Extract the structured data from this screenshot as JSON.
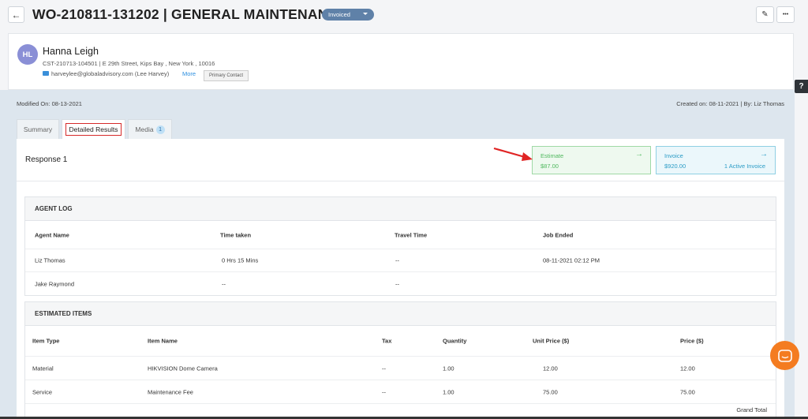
{
  "header": {
    "back_icon": "←",
    "title": "WO-210811-131202 | GENERAL MAINTENANCE",
    "status": "Invoiced",
    "edit_icon": "✎",
    "more_icon": "•••"
  },
  "customer": {
    "initials": "HL",
    "name": "Hanna Leigh",
    "address": "CST-210713-104501 | E 29th Street, Kips Bay , New York , 10016",
    "email": "harveylee@globaladvisory.com (Lee Harvey)",
    "more_label": "More",
    "badge": "Primary Contact"
  },
  "meta": {
    "modified": "Modified On: 08-13-2021",
    "created": "Created on: 08-11-2021 | By: Liz Thomas"
  },
  "tabs": {
    "summary": "Summary",
    "detailed": "Detailed Results",
    "media": "Media",
    "media_count": "1"
  },
  "response": {
    "title": "Response 1",
    "estimate": {
      "label": "Estimate",
      "amount": "$87.00",
      "arrow": "→"
    },
    "invoice": {
      "label": "Invoice",
      "amount": "$920.00",
      "extra": "1 Active Invoice",
      "arrow": "→"
    }
  },
  "agent_log": {
    "title": "AGENT LOG",
    "columns": [
      "Agent Name",
      "Time taken",
      "Travel Time",
      "Job Ended"
    ],
    "rows": [
      [
        "Liz Thomas",
        "0 Hrs 15 Mins",
        "--",
        "08-11-2021 02:12 PM"
      ],
      [
        "Jake Raymond",
        "--",
        "--",
        ""
      ]
    ]
  },
  "estimated_items": {
    "title": "ESTIMATED ITEMS",
    "columns": [
      "Item Type",
      "Item Name",
      "Tax",
      "Quantity",
      "Unit Price ($)",
      "Price ($)"
    ],
    "rows": [
      [
        "Material",
        "HIKVISION Dome Camera",
        "--",
        "1.00",
        "12.00",
        "12.00"
      ],
      [
        "Service",
        "Maintenance Fee",
        "--",
        "1.00",
        "75.00",
        "75.00"
      ]
    ],
    "grand_total": "Grand Total"
  },
  "widgets": {
    "help_icon": "?"
  },
  "colors": {
    "status_pill": "#5f81a8",
    "estimate_accent": "#4fb85e",
    "invoice_accent": "#2b9cc6",
    "chat_bubble": "#f47c20",
    "highlight_red": "#d62a2a"
  }
}
